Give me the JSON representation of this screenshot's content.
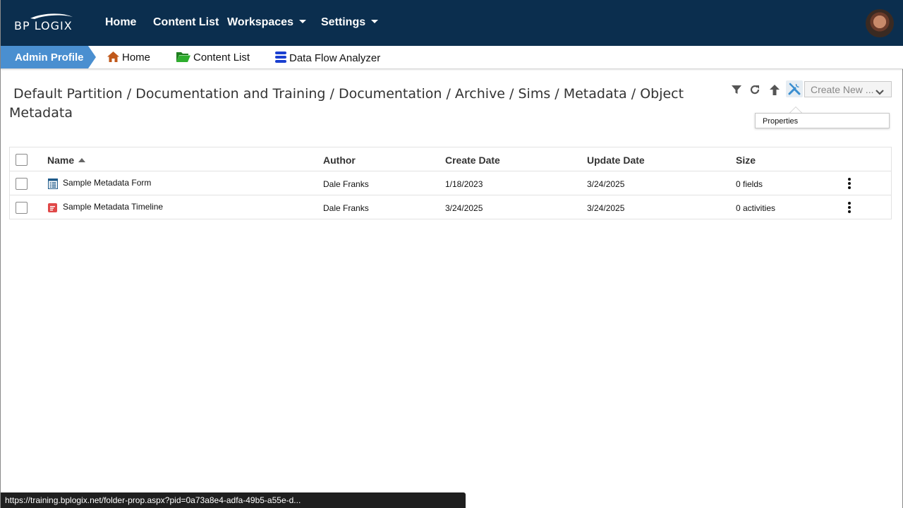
{
  "app": {
    "logo_text": "BP LOGIX"
  },
  "topnav": {
    "items": [
      {
        "label": "Home"
      },
      {
        "label": "Content List"
      },
      {
        "label": "Workspaces",
        "dropdown": true
      },
      {
        "label": "Settings",
        "dropdown": true
      }
    ],
    "avatar": "user-avatar"
  },
  "subnav": {
    "profile_label": "Admin Profile",
    "items": [
      {
        "label": "Home",
        "icon": "home-icon",
        "color": "#c0581a"
      },
      {
        "label": "Content List",
        "icon": "folder-open-icon",
        "color": "#2e9e2e"
      },
      {
        "label": "Data Flow Analyzer",
        "icon": "database-icon",
        "color": "#1a3fd0"
      }
    ]
  },
  "breadcrumb": {
    "parts": [
      "Default Partition",
      "Documentation and Training",
      "Documentation",
      "Archive",
      "Sims",
      "Metadata",
      "Object Metadata"
    ],
    "separator": " / "
  },
  "toolbar": {
    "icons": [
      "filter-icon",
      "refresh-icon",
      "up-arrow-icon",
      "tools-icon"
    ],
    "create_new_label": "Create New ...",
    "tooltip": "Properties",
    "accent": "#3a8ed0"
  },
  "table": {
    "headers": {
      "name": "Name",
      "author": "Author",
      "create_date": "Create Date",
      "update_date": "Update Date",
      "size": "Size"
    },
    "rows": [
      {
        "name": "Sample Metadata Form",
        "icon": "form-icon",
        "author": "Dale Franks",
        "create_date": "1/18/2023",
        "update_date": "3/24/2025",
        "size": "0 fields"
      },
      {
        "name": "Sample Metadata Timeline",
        "icon": "timeline-icon",
        "author": "Dale Franks",
        "create_date": "3/24/2025",
        "update_date": "3/24/2025",
        "size": "0 activities"
      }
    ]
  },
  "status": {
    "url": "https://training.bplogix.net/folder-prop.aspx?pid=0a73a8e4-adfa-49b5-a55e-d..."
  }
}
